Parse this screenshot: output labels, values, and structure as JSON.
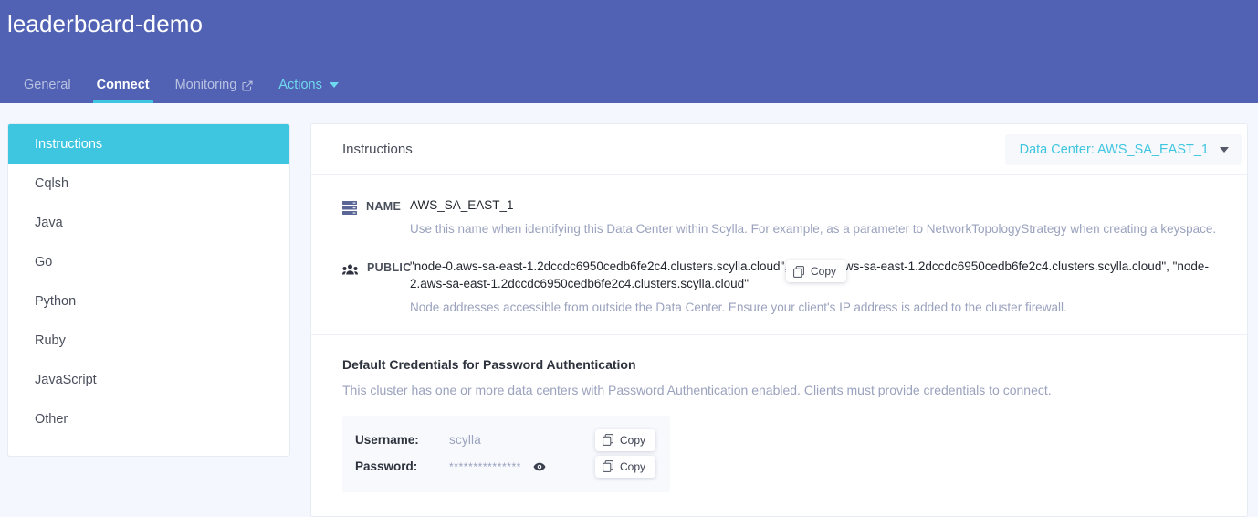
{
  "header": {
    "title": "leaderboard-demo",
    "tabs": [
      {
        "label": "General",
        "state": "inactive",
        "icon": ""
      },
      {
        "label": "Connect",
        "state": "active",
        "icon": ""
      },
      {
        "label": "Monitoring",
        "state": "inactive",
        "icon": "external-link-icon"
      },
      {
        "label": "Actions",
        "state": "accent",
        "icon": "chevron-down-icon"
      }
    ],
    "colors": {
      "bg": "#5162b4",
      "active_underline": "#3ec6e0",
      "accent_text": "#6fd9ef"
    }
  },
  "sidebar": {
    "items": [
      {
        "label": "Instructions",
        "active": true
      },
      {
        "label": "Cqlsh",
        "active": false
      },
      {
        "label": "Java",
        "active": false
      },
      {
        "label": "Go",
        "active": false
      },
      {
        "label": "Python",
        "active": false
      },
      {
        "label": "Ruby",
        "active": false
      },
      {
        "label": "JavaScript",
        "active": false
      },
      {
        "label": "Other",
        "active": false
      }
    ],
    "active_color": "#3ec6e0"
  },
  "main": {
    "card_title": "Instructions",
    "data_center_select": {
      "label": "Data Center: AWS_SA_EAST_1",
      "caret": "chevron-down-icon",
      "text_color": "#3ec6e0"
    },
    "details": [
      {
        "icon": "server-icon",
        "label": "NAME",
        "value": "AWS_SA_EAST_1",
        "description": "Use this name when identifying this Data Center within Scylla. For example, as a parameter to NetworkTopologyStrategy when creating a keyspace."
      },
      {
        "icon": "people-icon",
        "label": "PUBLIC",
        "value": "\"node-0.aws-sa-east-1.2dccdc6950cedb6fe2c4.clusters.scylla.cloud\", \"node-1.aws-sa-east-1.2dccdc6950cedb6fe2c4.clusters.scylla.cloud\", \"node-2.aws-sa-east-1.2dccdc6950cedb6fe2c4.clusters.scylla.cloud\"",
        "description": "Node addresses accessible from outside the Data Center. Ensure your client's IP address is added to the cluster firewall.",
        "copy_label": "Copy"
      }
    ],
    "credentials": {
      "title": "Default Credentials for Password Authentication",
      "description": "This cluster has one or more data centers with Password Authentication enabled. Clients must provide credentials to connect.",
      "rows": [
        {
          "key": "Username:",
          "value": "scylla",
          "masked": false,
          "copy_label": "Copy"
        },
        {
          "key": "Password:",
          "value": "***************",
          "masked": true,
          "reveal_icon": "eye-icon",
          "copy_label": "Copy"
        }
      ]
    }
  }
}
